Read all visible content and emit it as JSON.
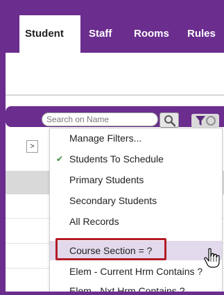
{
  "tabs": [
    {
      "label": "Student",
      "active": true
    },
    {
      "label": "Staff"
    },
    {
      "label": "Rooms"
    },
    {
      "label": "Rules"
    }
  ],
  "search": {
    "placeholder": "Search on Name"
  },
  "grid": {
    "expand_label": ">"
  },
  "filter_menu": {
    "items": [
      {
        "label": "Manage Filters...",
        "checked": false
      },
      {
        "label": "Students To Schedule",
        "checked": true
      },
      {
        "label": "Primary Students",
        "checked": false
      },
      {
        "label": "Secondary Students",
        "checked": false
      },
      {
        "label": "All Records",
        "checked": false
      },
      {
        "label": "Course Section = ?",
        "checked": false,
        "highlighted": true
      },
      {
        "label": "Elem - Current Hrm Contains ?",
        "checked": false
      },
      {
        "label": "Elem - Nxt Hrm Contains ?",
        "checked": false
      }
    ],
    "check_glyph": "✔"
  },
  "colors": {
    "brand": "#6b2d8e",
    "highlight": "#e3d9ec",
    "annotation": "#b31c25",
    "check": "#3a8a3a"
  },
  "icons": [
    "magnifier-icon",
    "filter-funnel-icon",
    "checkmark-icon",
    "hand-pointer-cursor-icon"
  ]
}
